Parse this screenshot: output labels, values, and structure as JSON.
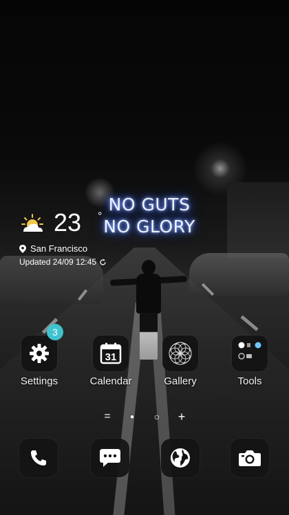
{
  "wallpaper": {
    "neon_line_1": "NO GUTS",
    "neon_line_2": "NO GLORY"
  },
  "weather": {
    "icon": "partly-sunny-icon",
    "temperature": "23",
    "degree_symbol": "°",
    "location": "San Francisco",
    "updated": "Updated 24/09 12:45",
    "accent_color": "#f2c94c"
  },
  "apps": [
    {
      "label": "Settings",
      "icon": "gear-icon",
      "badge": "3"
    },
    {
      "label": "Calendar",
      "icon": "calendar-icon",
      "date": "31"
    },
    {
      "label": "Gallery",
      "icon": "gallery-icon"
    },
    {
      "label": "Tools",
      "icon": "tools-folder-icon"
    }
  ],
  "pager": {
    "items": [
      "=",
      "●",
      "○",
      "+"
    ]
  },
  "dock": [
    {
      "icon": "phone-icon"
    },
    {
      "icon": "messages-icon"
    },
    {
      "icon": "browser-icon"
    },
    {
      "icon": "camera-icon"
    }
  ],
  "colors": {
    "badge": "#3fc3cf",
    "neon_glow": "#4c7dff"
  }
}
